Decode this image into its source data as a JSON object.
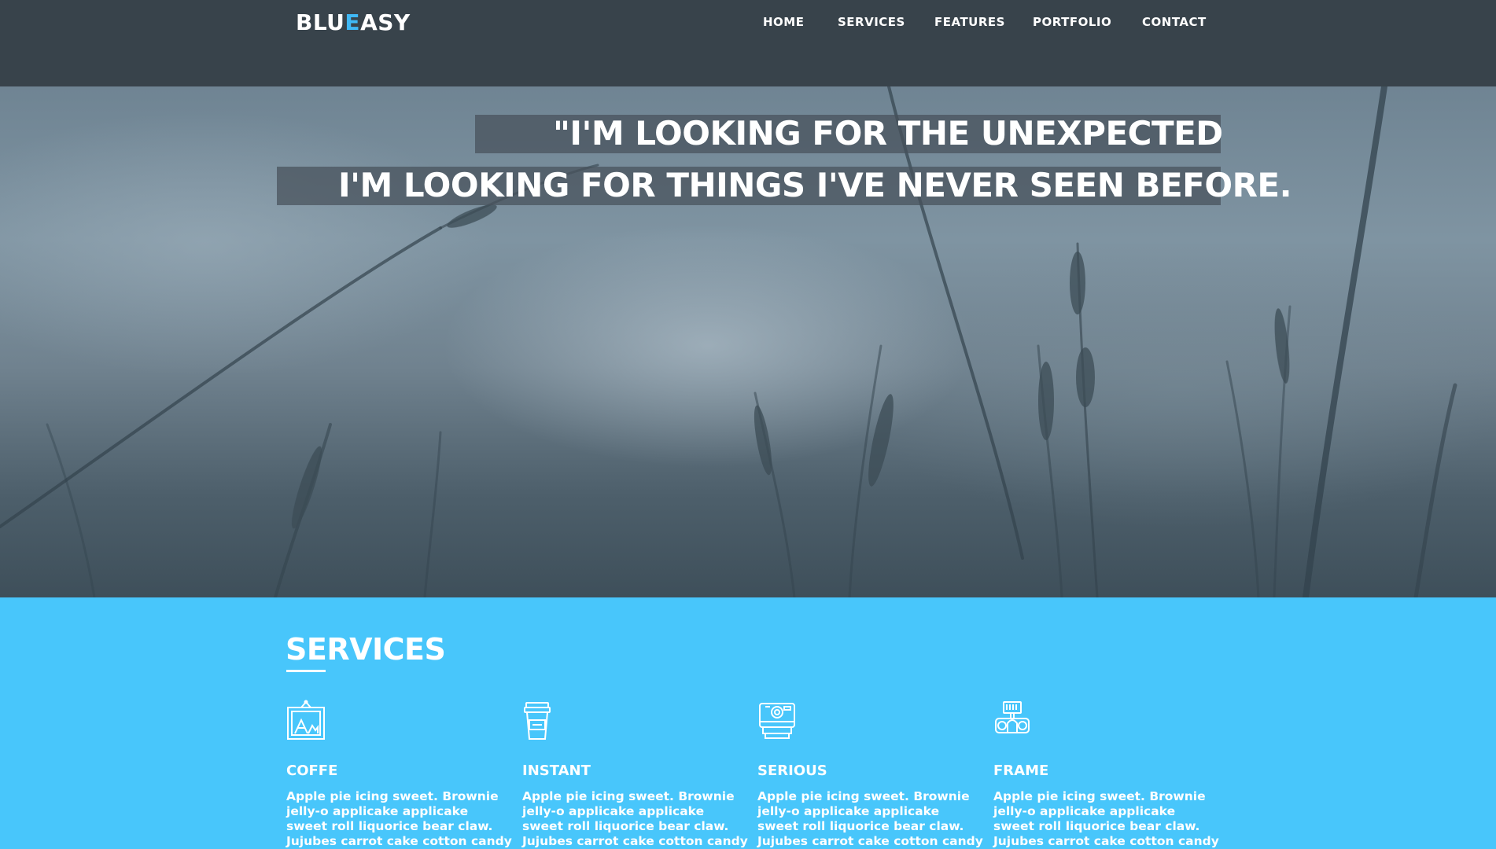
{
  "header": {
    "logo": {
      "part1": "BLU",
      "accent": "E",
      "part2": "ASY"
    },
    "nav": [
      "HOME",
      "SERVICES",
      "FEATURES",
      "PORTFOLIO",
      "CONTACT"
    ]
  },
  "hero": {
    "quote_line1": "\"I'M LOOKING FOR THE UNEXPECTED",
    "quote_line2": "I'M LOOKING FOR THINGS I'VE NEVER SEEN BEFORE."
  },
  "services": {
    "title": "SERVICES",
    "items": [
      {
        "icon": "picture-frame-icon",
        "title": "COFFE",
        "text": "Apple pie icing sweet. Brownie jelly-o applicake applicake sweet roll liquorice bear claw. Jujubes carrot cake cotton candy sweet"
      },
      {
        "icon": "coffee-cup-icon",
        "title": "INSTANT",
        "text": "Apple pie icing sweet. Brownie jelly-o applicake applicake sweet roll liquorice bear claw. Jujubes carrot cake cotton candy sweet"
      },
      {
        "icon": "instant-camera-icon",
        "title": "SERIOUS",
        "text": "Apple pie icing sweet. Brownie jelly-o applicake applicake sweet roll liquorice bear claw. Jujubes carrot cake cotton candy sweet"
      },
      {
        "icon": "camera-icon",
        "title": "FRAME",
        "text": "Apple pie icing sweet. Brownie jelly-o applicake applicake sweet roll liquorice bear claw. Jujubes carrot cake cotton candy sweet"
      }
    ]
  },
  "colors": {
    "header_bg": "#38434b",
    "accent": "#3fb8f5",
    "services_bg": "#48c6fb",
    "text": "#ffffff"
  }
}
